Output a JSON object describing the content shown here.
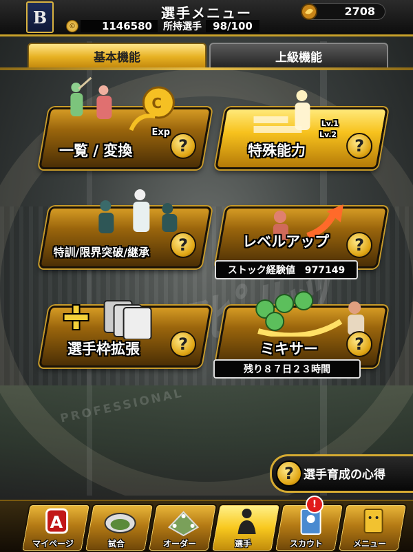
{
  "header": {
    "title": "選手メニュー",
    "team_logo_letter": "B",
    "gems": "2708",
    "coins": "1146580",
    "owned_label": "所持選手",
    "owned_count": "98/100"
  },
  "tabs": [
    {
      "label": "基本機能",
      "active": true
    },
    {
      "label": "上級機能",
      "active": false
    }
  ],
  "menu": {
    "list_exchange": {
      "label": "一覧 / 変換",
      "art_text": "Exp"
    },
    "special_ability": {
      "label": "特殊能力",
      "lv1": "Lv.1",
      "lv2": "Lv.2"
    },
    "training": {
      "label": "特訓/限界突破/継承"
    },
    "level_up": {
      "label": "レベルアップ",
      "sub_label": "ストック経験値　977149"
    },
    "slot_expand": {
      "label": "選手枠拡張"
    },
    "mixer": {
      "label": "ミキサー",
      "sub_label": "残り８７日２３時間"
    }
  },
  "guide": {
    "label": "選手育成の心得"
  },
  "help_symbol": "?",
  "nav": [
    {
      "label": "マイページ",
      "icon": "mypage-icon"
    },
    {
      "label": "試合",
      "icon": "stadium-icon"
    },
    {
      "label": "オーダー",
      "icon": "field-order-icon"
    },
    {
      "label": "選手",
      "icon": "player-icon",
      "active": true
    },
    {
      "label": "スカウト",
      "icon": "scout-card-icon",
      "badge": "!"
    },
    {
      "label": "メニュー",
      "icon": "menu-box-icon"
    }
  ],
  "colors": {
    "gold": "#e7b123",
    "dark_gold": "#9a650c",
    "badge_red": "#e11b1b"
  }
}
